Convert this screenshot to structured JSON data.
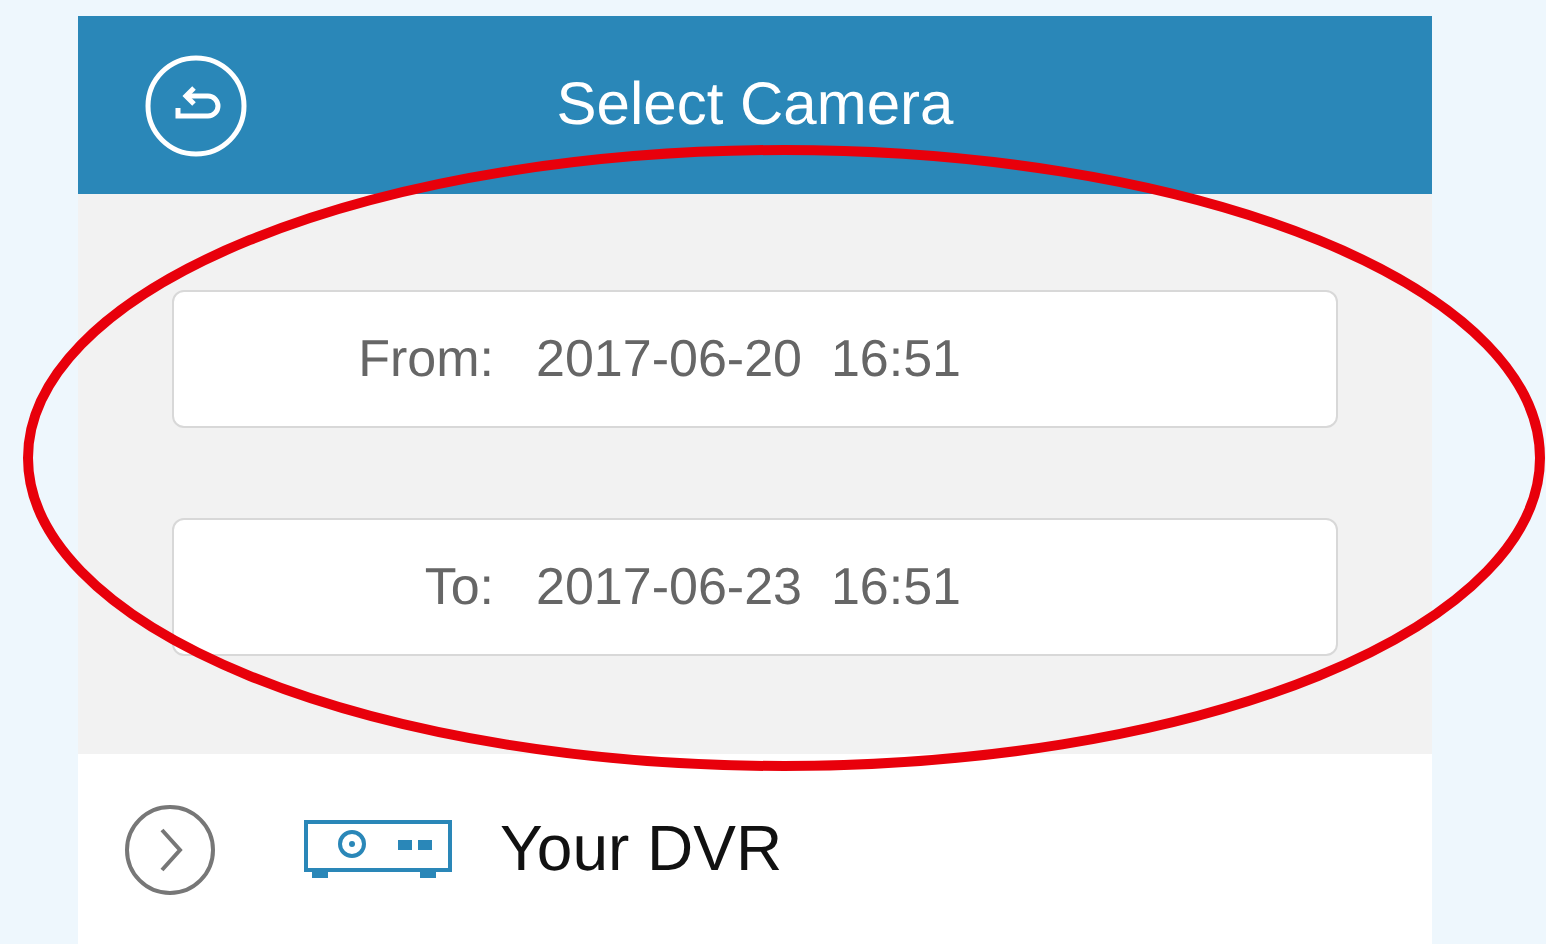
{
  "header": {
    "title": "Select Camera"
  },
  "date_range": [
    {
      "label": "From:",
      "value": "2017-06-20  16:51"
    },
    {
      "label": "To:",
      "value": "2017-06-23  16:51"
    }
  ],
  "devices": [
    {
      "name": "Your DVR",
      "expanded": false
    }
  ],
  "annotation": {
    "kind": "ellipse"
  }
}
